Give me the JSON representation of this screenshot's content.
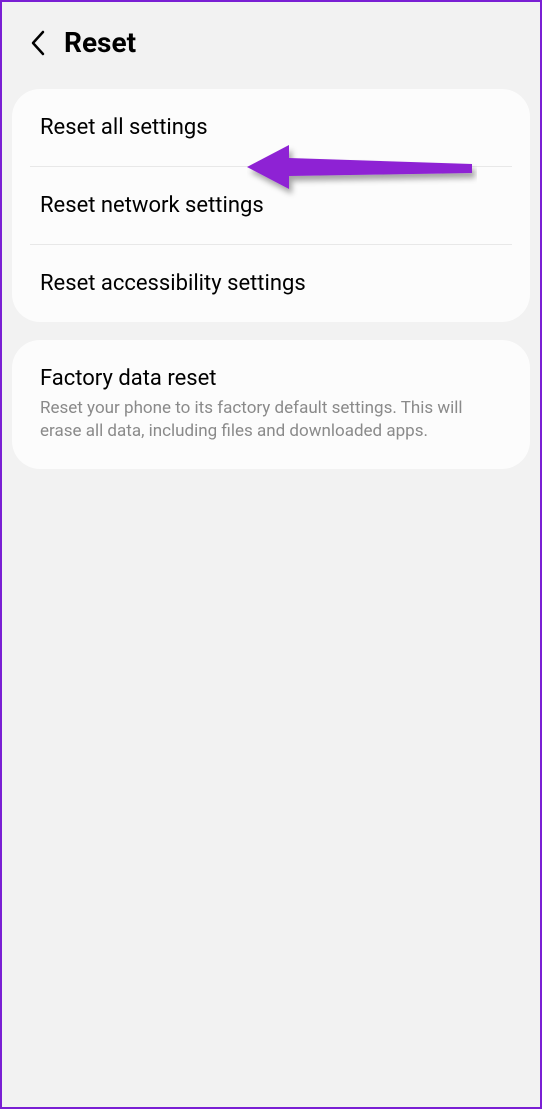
{
  "header": {
    "title": "Reset"
  },
  "group1": {
    "items": [
      {
        "title": "Reset all settings"
      },
      {
        "title": "Reset network settings"
      },
      {
        "title": "Reset accessibility settings"
      }
    ]
  },
  "group2": {
    "items": [
      {
        "title": "Factory data reset",
        "description": "Reset your phone to its factory default settings. This will erase all data, including files and downloaded apps."
      }
    ]
  }
}
